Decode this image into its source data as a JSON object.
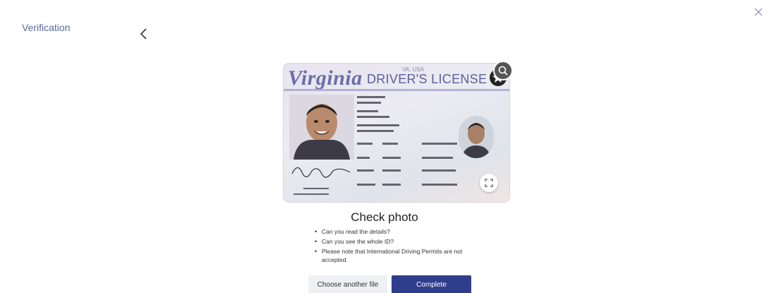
{
  "header": {
    "title": "Verification"
  },
  "icons": {
    "back": "chevron-left-icon",
    "close": "close-icon",
    "zoom": "search-icon",
    "expand": "expand-icon"
  },
  "id_card": {
    "state": "Virginia",
    "type": "DRIVER'S LICENSE",
    "country": "VA, USA"
  },
  "check": {
    "heading": "Check photo",
    "tips": [
      "Can you read the details?",
      "Can you see the whole ID?",
      "Please note that International Driving Permits are not accepted."
    ]
  },
  "actions": {
    "secondary_label": "Choose another file",
    "primary_label": "Complete"
  },
  "colors": {
    "primary": "#2f3e8c",
    "title_text": "#5b6a9a",
    "secondary_bg": "#eef0f3"
  }
}
